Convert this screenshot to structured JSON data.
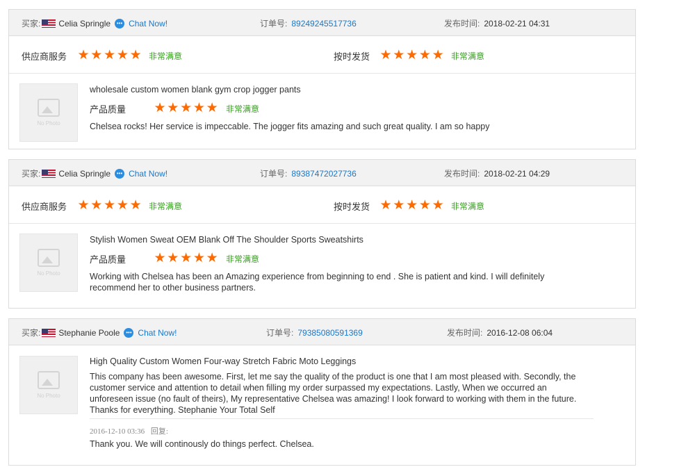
{
  "labels": {
    "buyer": "买家:",
    "order": "订单号:",
    "date": "发布时间:",
    "supplier_service": "供应商服务",
    "shipping": "按时发货",
    "product_quality": "产品质量",
    "very_satisfied": "非常满意",
    "chat_now": "Chat Now!",
    "no_photo": "No Photo",
    "reply_label": "回复:"
  },
  "reviews": [
    {
      "buyer_name": "Celia Springle",
      "order_no": "89249245517736",
      "published": "2018-02-21 04:31",
      "product": "wholesale custom women blank gym crop jogger pants",
      "supplier_rating": 5,
      "shipping_rating": 5,
      "quality_rating": 5,
      "comment": "Chelsea rocks! Her service is impeccable. The jogger fits amazing and such great quality. I am so happy"
    },
    {
      "buyer_name": "Celia Springle",
      "order_no": "89387472027736",
      "published": "2018-02-21 04:29",
      "product": "Stylish Women Sweat OEM Blank Off The Shoulder Sports Sweatshirts",
      "supplier_rating": 5,
      "shipping_rating": 5,
      "quality_rating": 5,
      "comment": "Working with Chelsea has been an Amazing experience from beginning to end . She is patient and kind. I will definitely recommend her to other business partners."
    },
    {
      "buyer_name": "Stephanie Poole",
      "order_no": "79385080591369",
      "published": "2016-12-08 06:04",
      "product": "High Quality Custom Women Four-way Stretch Fabric Moto Leggings",
      "comment": "This company has been awesome. First, let me say the quality of the product is one that I am most pleased with. Secondly, the customer service and attention to detail when filling my order surpassed my expectations. Lastly, When we occurred an unforeseen issue (no fault of theirs), My representative Chelsea was amazing!  I look forward to working with them in the future. Thanks for everything.   Stephanie Your Total Self",
      "reply_date": "2016-12-10 03:36",
      "reply": "Thank you. We will continously do things perfect. Chelsea."
    }
  ],
  "colors": {
    "star": "#ff6a00",
    "satisfied": "#3a9d23",
    "link": "#1a77c9",
    "header_bg": "#f2f2f2"
  }
}
